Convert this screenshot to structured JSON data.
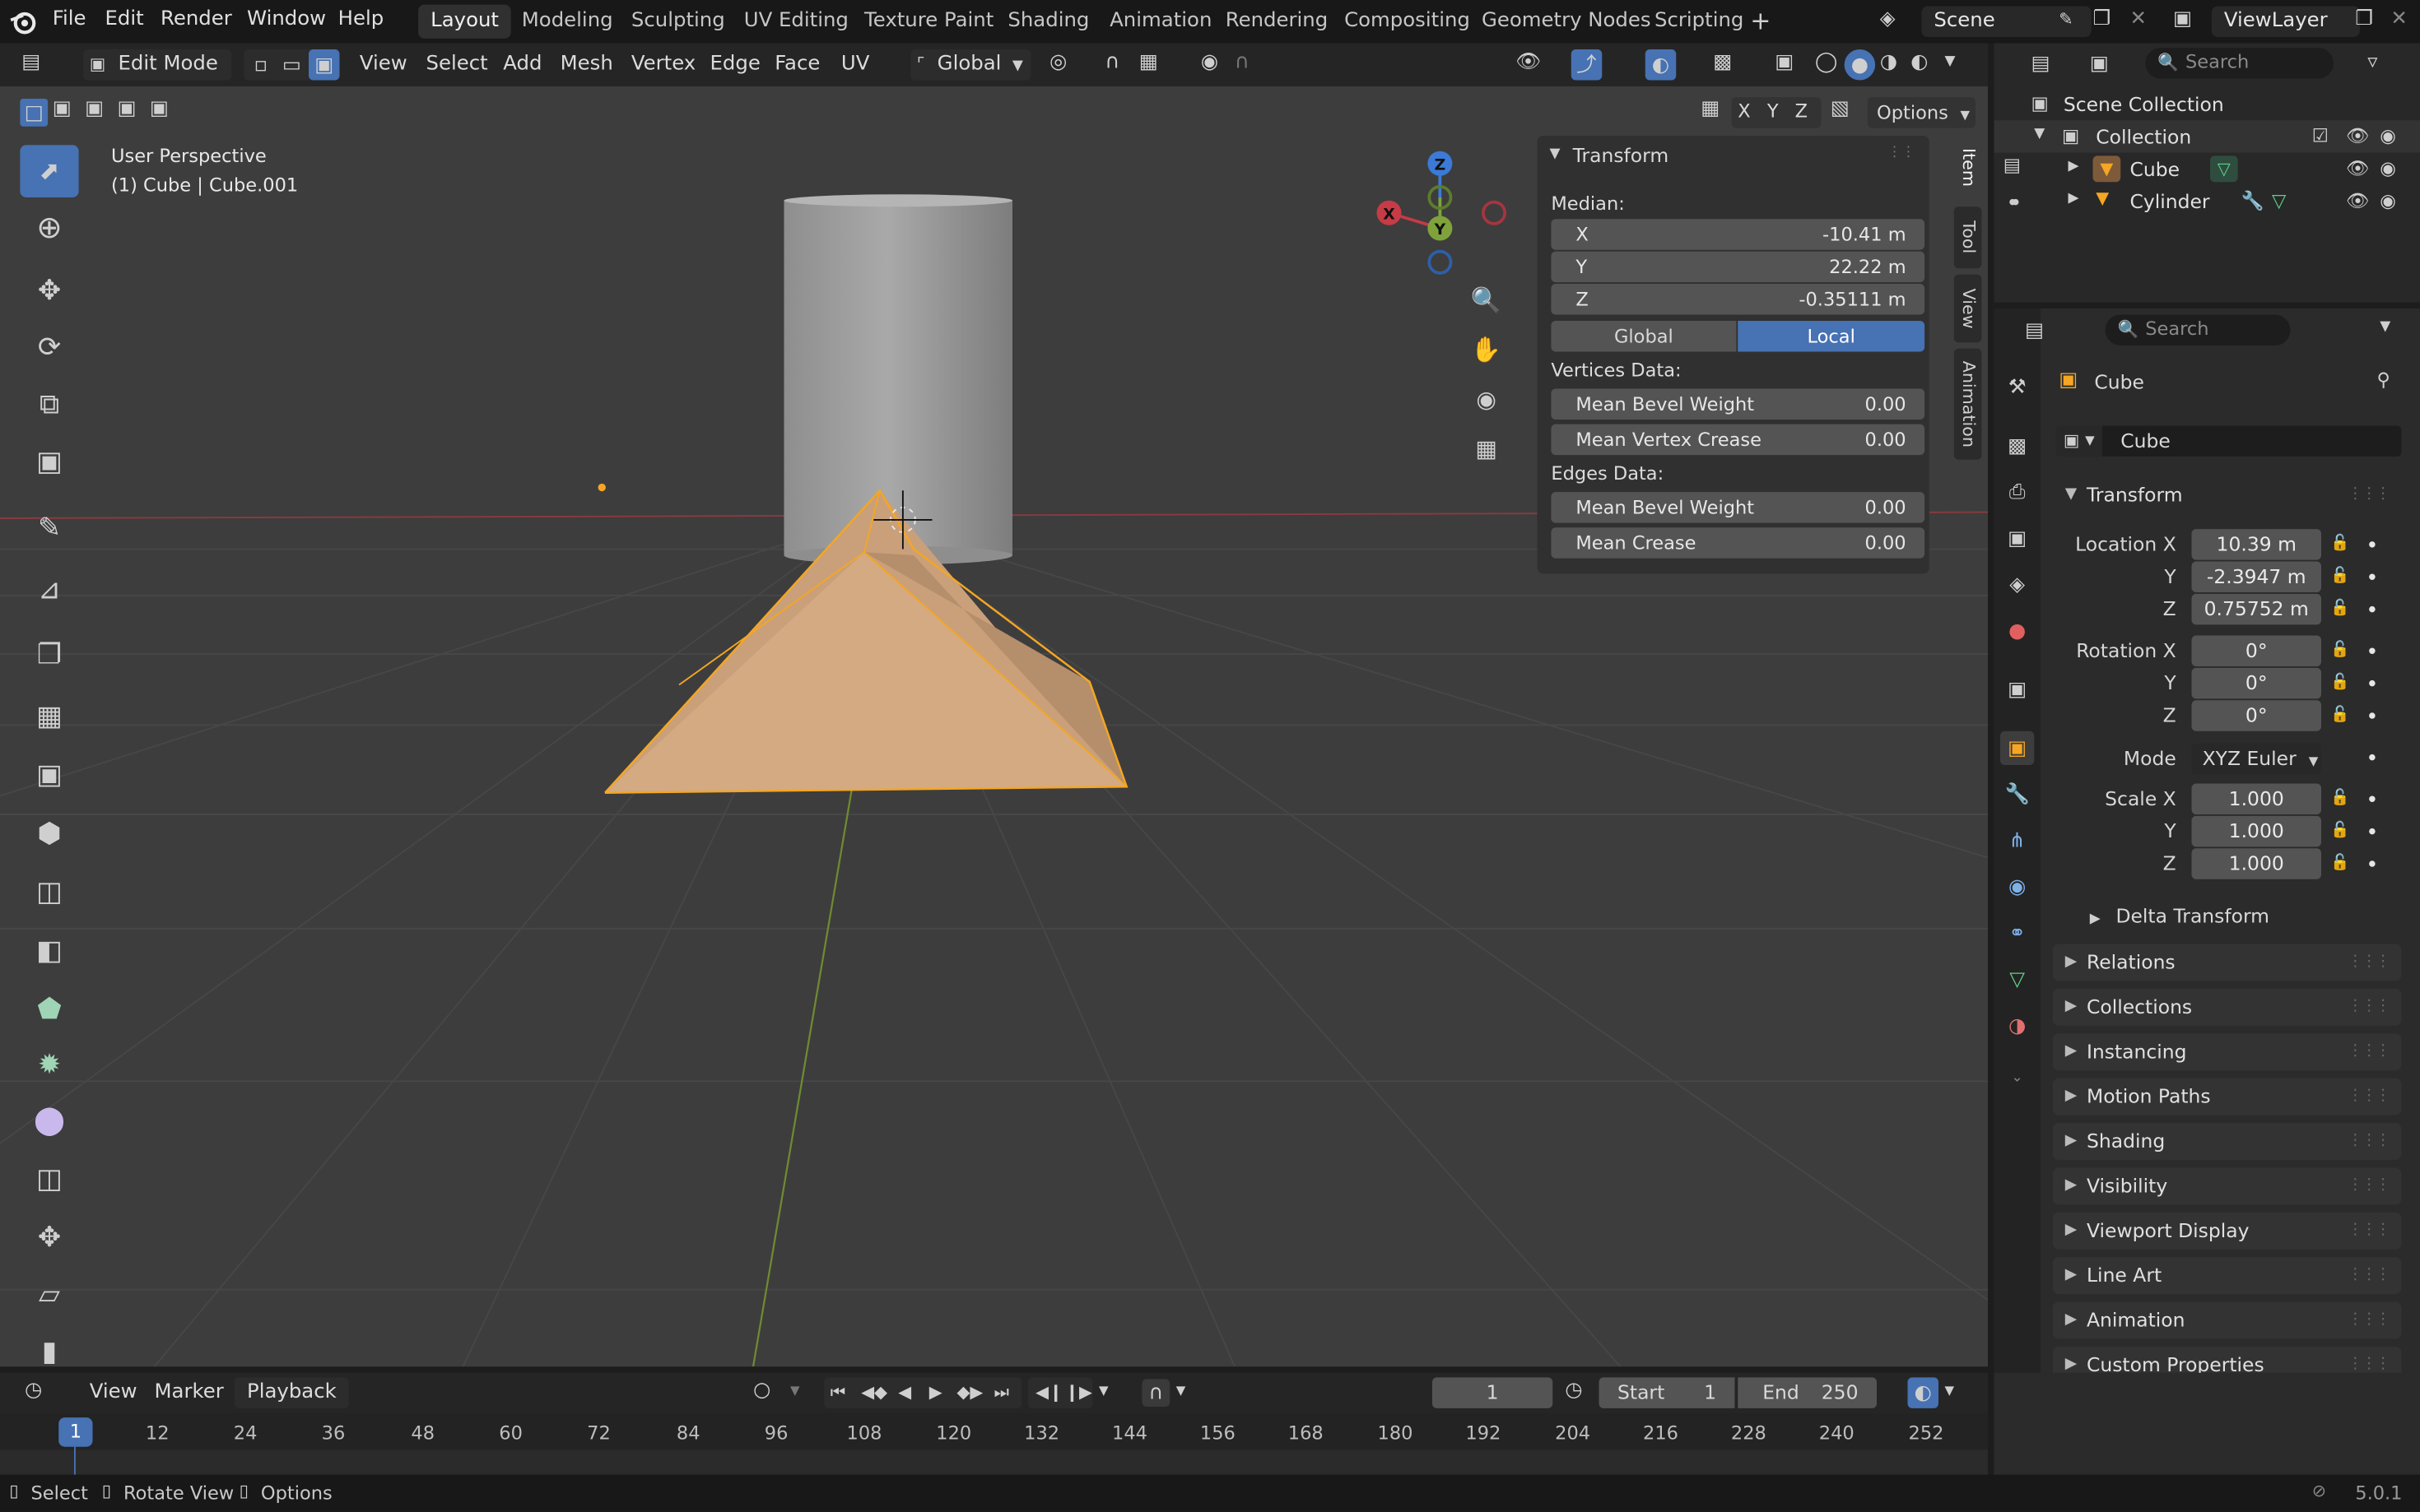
{
  "topbar": {
    "menus": [
      "File",
      "Edit",
      "Render",
      "Window",
      "Help"
    ],
    "workspaces": [
      "Layout",
      "Modeling",
      "Sculpting",
      "UV Editing",
      "Texture Paint",
      "Shading",
      "Animation",
      "Rendering",
      "Compositing",
      "Geometry Nodes",
      "Scripting"
    ],
    "active_workspace": "Layout",
    "scene": "Scene",
    "view_layer": "ViewLayer"
  },
  "viewport_header": {
    "mode": "Edit Mode",
    "menus": [
      "View",
      "Select",
      "Add",
      "Mesh",
      "Vertex",
      "Edge",
      "Face",
      "UV"
    ],
    "orientation": "Global",
    "axis_toggles": [
      "X",
      "Y",
      "Z"
    ],
    "options_label": "Options"
  },
  "viewport": {
    "view_name": "User Perspective",
    "object_info": "(1) Cube | Cube.001",
    "gizmo_axes": {
      "z": "Z",
      "y": "Y",
      "x": "X"
    },
    "colors": {
      "background": "#3d3d3d",
      "selected_mesh": "#c9a07a",
      "edge_highlight": "#f5a623",
      "x_axis": "#c63b45",
      "y_axis": "#7fa33a",
      "z_axis": "#3b7ad6",
      "active": "#4772b3"
    }
  },
  "npanel": {
    "tabs": [
      "Item",
      "Tool",
      "View",
      "Animation"
    ],
    "title": "Transform",
    "median_label": "Median:",
    "median": [
      {
        "label": "X",
        "value": "-10.41 m"
      },
      {
        "label": "Y",
        "value": "22.22 m"
      },
      {
        "label": "Z",
        "value": "-0.35111 m"
      }
    ],
    "space_buttons": [
      "Global",
      "Local"
    ],
    "active_space": "Local",
    "vertices_label": "Vertices Data:",
    "vertices": [
      {
        "label": "Mean Bevel Weight",
        "value": "0.00"
      },
      {
        "label": "Mean Vertex Crease",
        "value": "0.00"
      }
    ],
    "edges_label": "Edges Data:",
    "edges": [
      {
        "label": "Mean Bevel Weight",
        "value": "0.00"
      },
      {
        "label": "Mean Crease",
        "value": "0.00"
      }
    ]
  },
  "outliner": {
    "search_placeholder": "Search",
    "root": "Scene Collection",
    "collection": "Collection",
    "items": [
      "Cube",
      "Cylinder"
    ]
  },
  "properties": {
    "search_placeholder": "Search",
    "object_name": "Cube",
    "datablock_name": "Cube",
    "transform_title": "Transform",
    "location_label": "Location X",
    "rotation_label": "Rotation X",
    "scale_label": "Scale X",
    "axis_y": "Y",
    "axis_z": "Z",
    "location": [
      "10.39 m",
      "-2.3947 m",
      "0.75752 m"
    ],
    "rotation": [
      "0°",
      "0°",
      "0°"
    ],
    "mode_label": "Mode",
    "mode_value": "XYZ Euler",
    "scale": [
      "1.000",
      "1.000",
      "1.000"
    ],
    "delta": "Delta Transform",
    "panels": [
      "Relations",
      "Collections",
      "Instancing",
      "Motion Paths",
      "Shading",
      "Visibility",
      "Viewport Display",
      "Line Art",
      "Animation",
      "Custom Properties"
    ]
  },
  "timeline": {
    "menus": [
      "View",
      "Marker",
      "Playback"
    ],
    "current_frame": "1",
    "start_label": "Start",
    "start": "1",
    "end_label": "End",
    "end": "250",
    "ticks": [
      "1",
      "12",
      "24",
      "36",
      "48",
      "60",
      "72",
      "84",
      "96",
      "108",
      "120",
      "132",
      "144",
      "156",
      "168",
      "180",
      "192",
      "204",
      "216",
      "228",
      "240",
      "252"
    ]
  },
  "statusbar": {
    "items": [
      "Select",
      "Rotate View",
      "Options"
    ],
    "version": "5.0.1"
  }
}
